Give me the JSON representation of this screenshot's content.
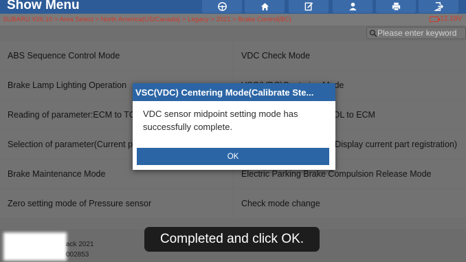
{
  "header": {
    "title": "Show Menu"
  },
  "toolbar": {
    "icons": [
      "steering-wheel-icon",
      "home-icon",
      "report-icon",
      "user-icon",
      "print-icon",
      "exit-icon"
    ]
  },
  "breadcrumb": "SUBARU V26.10 > Area Select > North America(US/Canada) > Legacy > 2021 > Brake Control(BC)",
  "battery": {
    "voltage": "12.19V"
  },
  "search": {
    "placeholder": "Please enter keyword"
  },
  "menu": {
    "items": [
      "ABS Sequence Control Mode",
      "VDC Check Mode",
      "Brake Lamp Lighting Operation",
      "VSC(VDC)Centering Mode",
      "Reading of parameter:ECM to TOOL",
      "Writing of parameter:TOOL to ECM",
      "Selection of parameter(Current part registration)",
      "Selection of parameters(Display current part registration)",
      "Brake Maintenance Mode",
      "Electric Parking Brake Compulsion Release Mode",
      "Zero setting mode of Pressure sensor",
      "Check mode change"
    ]
  },
  "footer": {
    "line1": "ack 2021",
    "line2": "002853"
  },
  "dialog": {
    "title": "VSC(VDC) Centering Mode(Calibrate Ste...",
    "message": "VDC sensor midpoint setting mode has successfully complete.",
    "ok_label": "OK"
  },
  "subtitle": "Completed and click OK."
}
